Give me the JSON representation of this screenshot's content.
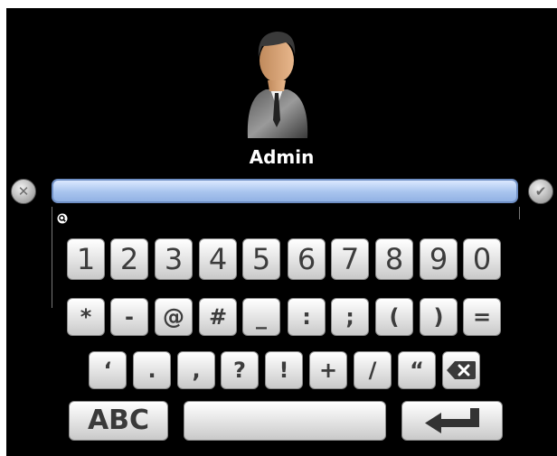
{
  "login": {
    "username": "Admin",
    "password_value": ""
  },
  "keyboard": {
    "row1": [
      "1",
      "2",
      "3",
      "4",
      "5",
      "6",
      "7",
      "8",
      "9",
      "0"
    ],
    "row2": [
      "*",
      "-",
      "@",
      "#",
      "_",
      ":",
      ";",
      "(",
      ")",
      "="
    ],
    "row3": [
      "‘",
      ".",
      ",",
      "?",
      "!",
      "+",
      "/",
      "“"
    ],
    "mode_key": "ABC"
  },
  "icons": {
    "clear": "clear-icon",
    "confirm": "checkmark-icon",
    "backspace": "backspace-icon",
    "enter": "enter-arrow-icon",
    "search": "search-icon",
    "avatar": "user-avatar"
  },
  "colors": {
    "field": "#a8c4ee",
    "field_border": "#6f8fc4",
    "key": "#e2e2e2",
    "background": "#000000"
  }
}
